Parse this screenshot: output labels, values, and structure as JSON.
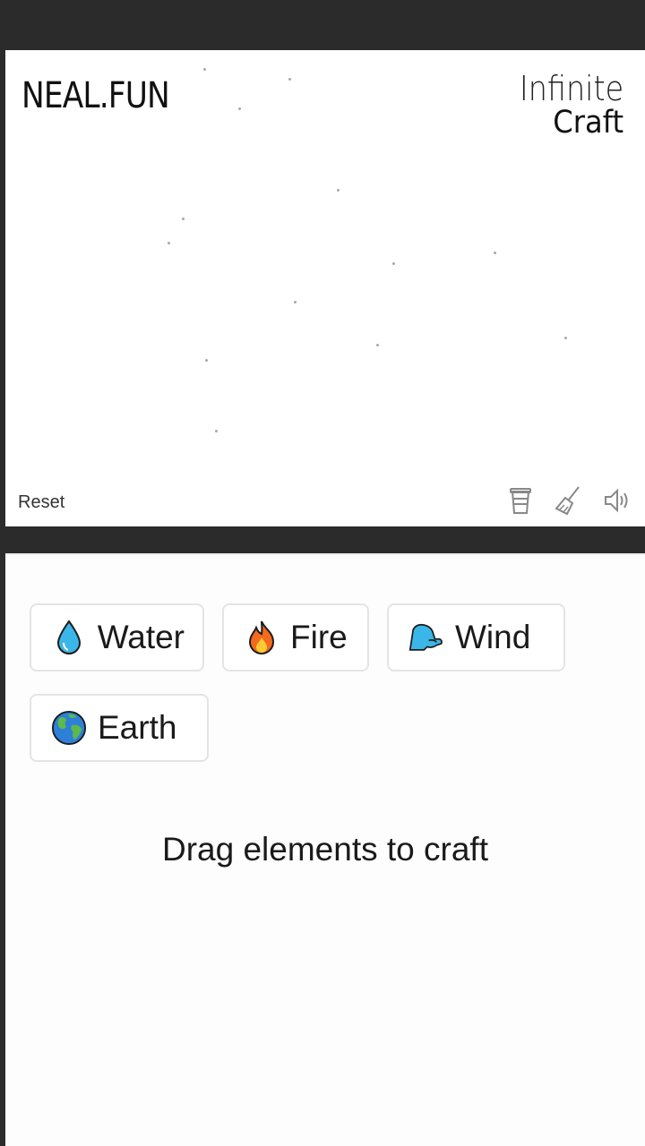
{
  "header": {
    "logo": "NEAL.FUN",
    "title_line1": "Infinite",
    "title_line2": "Craft"
  },
  "canvas": {
    "reset_label": "Reset",
    "tools": [
      {
        "name": "coffee-cup-icon"
      },
      {
        "name": "broom-icon"
      },
      {
        "name": "speaker-icon"
      }
    ]
  },
  "sidebar": {
    "items": [
      {
        "label": "Water",
        "icon": "water-drop-icon",
        "color": "#3bb6e8"
      },
      {
        "label": "Fire",
        "icon": "fire-icon",
        "color": "#f46a1f"
      },
      {
        "label": "Wind",
        "icon": "wind-icon",
        "color": "#3ab6e8"
      },
      {
        "label": "Earth",
        "icon": "earth-globe-icon",
        "color": "#2d7fd8"
      }
    ],
    "hint": "Drag elements to craft"
  }
}
